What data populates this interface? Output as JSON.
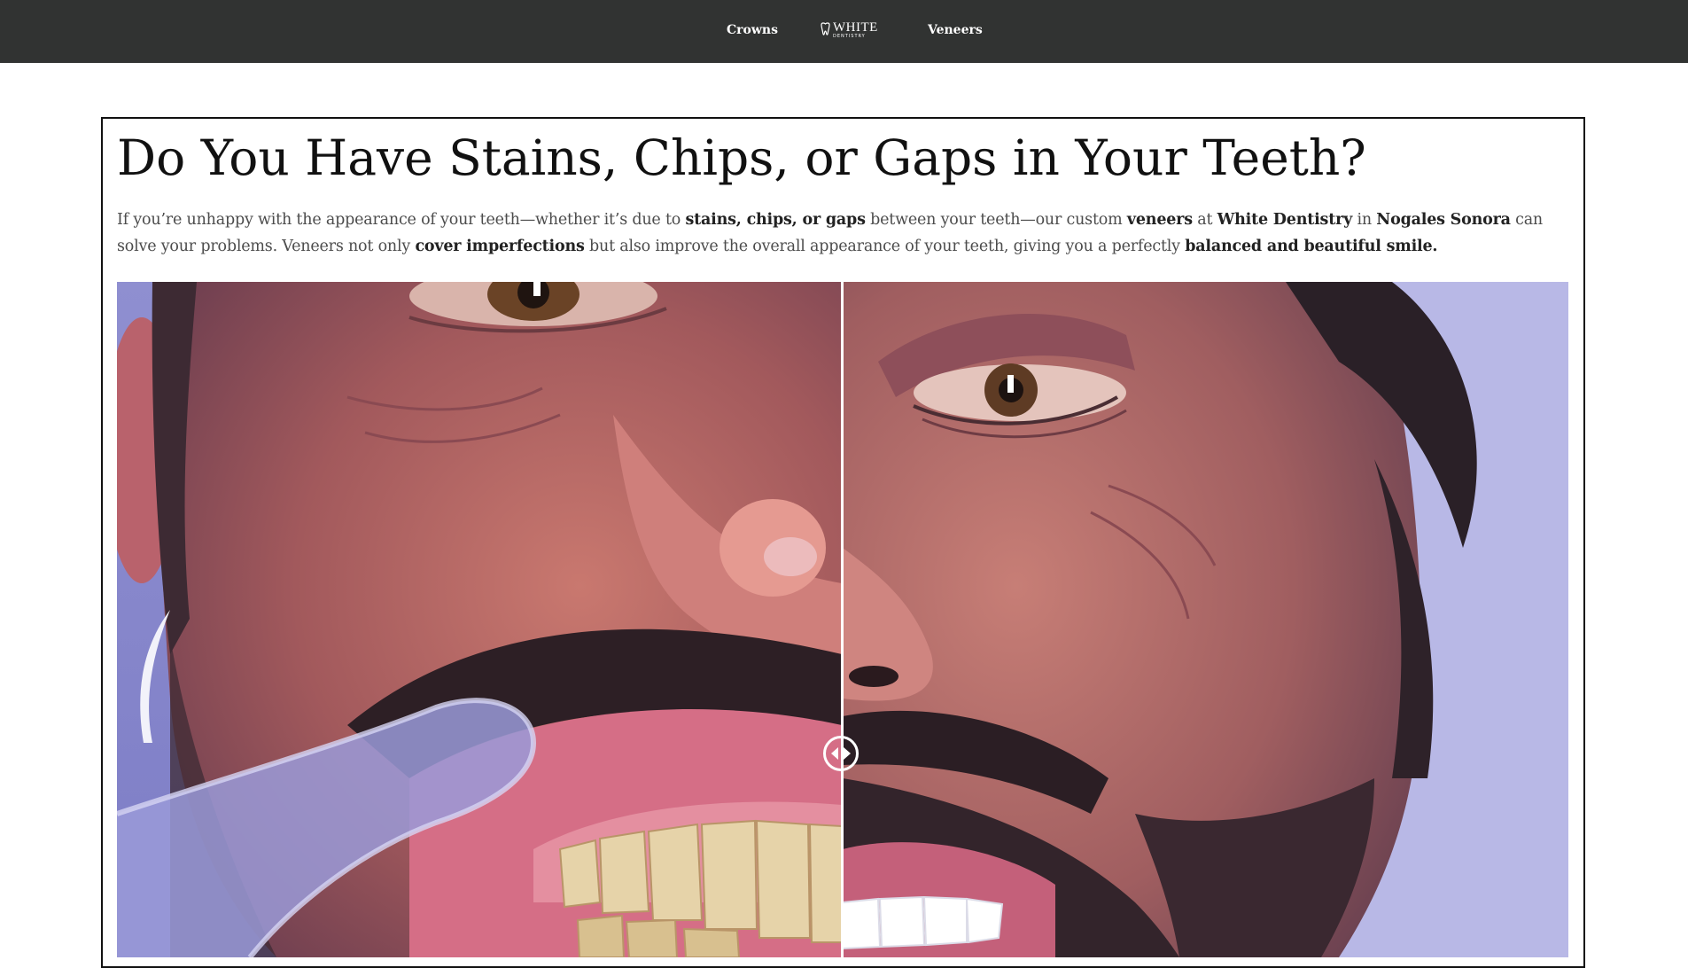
{
  "nav": {
    "left_link": "Crowns",
    "right_link": "Veneers",
    "logo": {
      "word": "WHITE",
      "sub": "DENTISTRY"
    }
  },
  "article": {
    "headline": "Do You Have Stains, Chips, or Gaps in Your Teeth?",
    "intro": {
      "t1": "If you’re unhappy with the appearance of your teeth—whether it’s due to ",
      "b1": "stains, chips, or gaps",
      "t2": " between your teeth—our custom ",
      "b2": "veneers",
      "t3": " at ",
      "b3": "White Dentistry",
      "t4": " in ",
      "b4": "Nogales Sonora",
      "t5": " can solve your problems. Veneers not only ",
      "b5": "cover imperfections",
      "t6": " but also improve the overall appearance of your teeth, giving you a perfectly ",
      "b6": "balanced and beautiful smile."
    }
  },
  "comparison": {
    "left_image": "before-photo-stained-teeth",
    "right_image": "after-photo-veneers",
    "handle_icon": "arrows-left-right-icon",
    "divider_color": "#ffffff"
  },
  "colors": {
    "topbar": "#313332",
    "text": "#111111",
    "body_text": "#4c4c4c",
    "photo_background": "#b6b5e4"
  }
}
